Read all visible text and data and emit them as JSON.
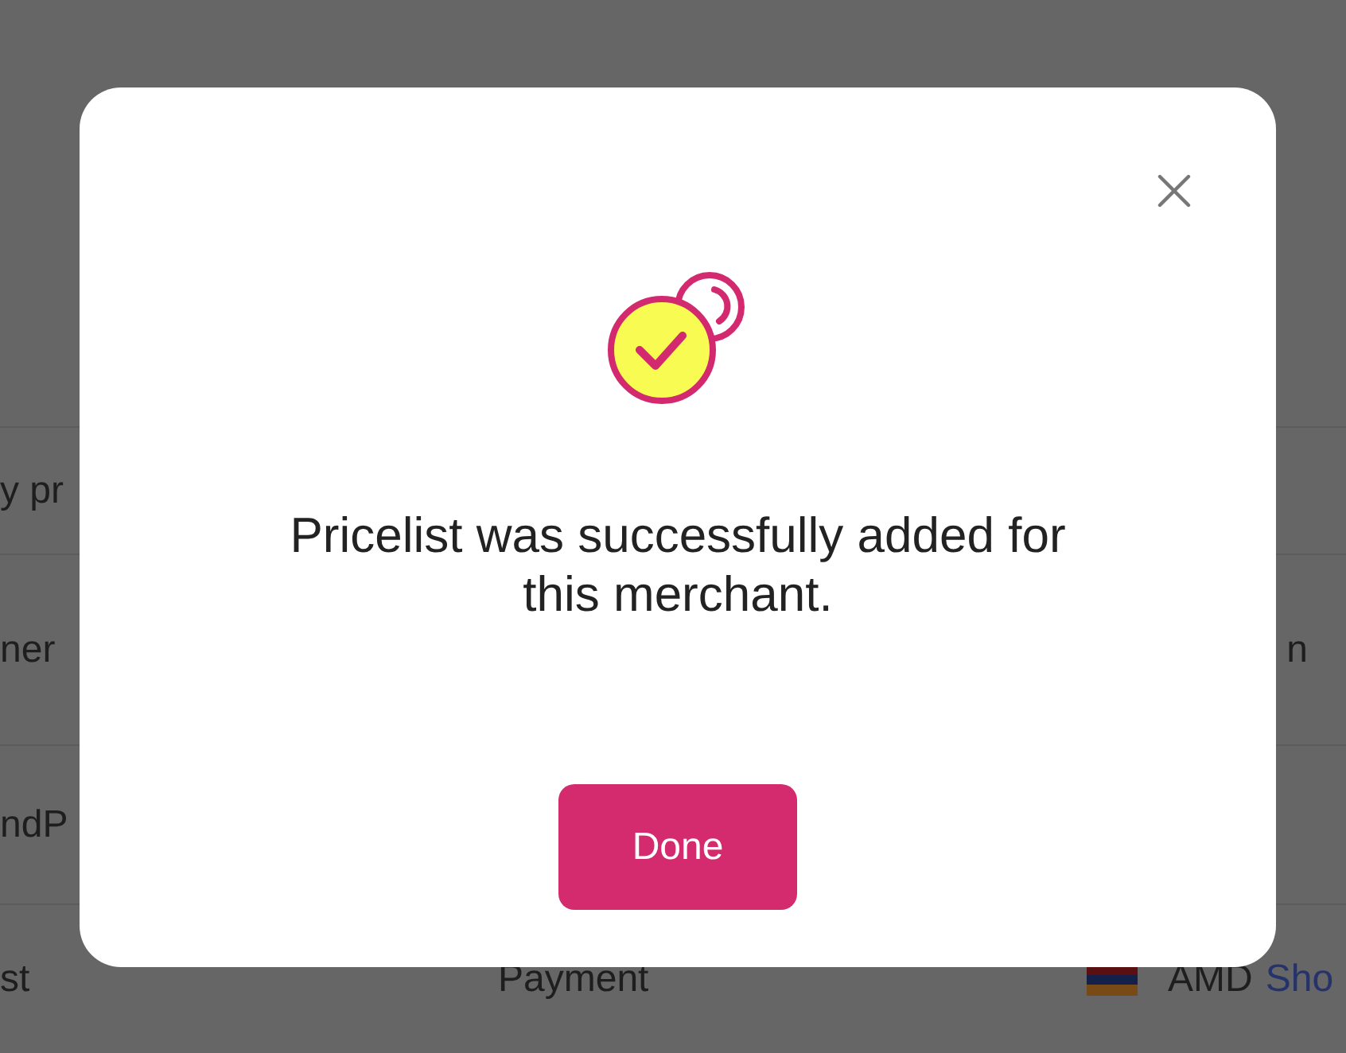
{
  "page": {
    "search_value": "y pr",
    "header": [
      "ner",
      "n"
    ],
    "rows": [
      {
        "cells": [
          "ndP"
        ]
      },
      {
        "cells": [
          "st",
          "Payment"
        ],
        "currency": "AMD",
        "link": "Sho"
      }
    ]
  },
  "dialog": {
    "message": "Pricelist was successfully added for this merchant.",
    "button": "Done"
  }
}
